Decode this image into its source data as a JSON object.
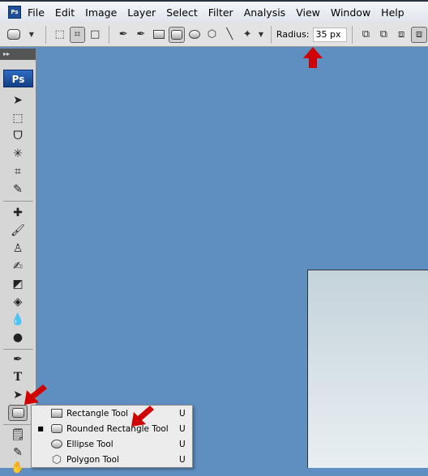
{
  "menubar": {
    "logo": "Ps",
    "items": [
      "File",
      "Edit",
      "Image",
      "Layer",
      "Select",
      "Filter",
      "Analysis",
      "View",
      "Window",
      "Help"
    ]
  },
  "options": {
    "radius_label": "Radius:",
    "radius_value": "35 px"
  },
  "toolpanel": {
    "header": "▸▸",
    "logo": "Ps"
  },
  "flyout": {
    "items": [
      {
        "label": "Rectangle Tool",
        "key": "U",
        "active": false
      },
      {
        "label": "Rounded Rectangle Tool",
        "key": "U",
        "active": true
      },
      {
        "label": "Ellipse Tool",
        "key": "U",
        "active": false
      },
      {
        "label": "Polygon Tool",
        "key": "U",
        "active": false
      }
    ]
  },
  "colors": {
    "canvas": "#5e8fc0",
    "annotation_arrow": "#d00000"
  }
}
